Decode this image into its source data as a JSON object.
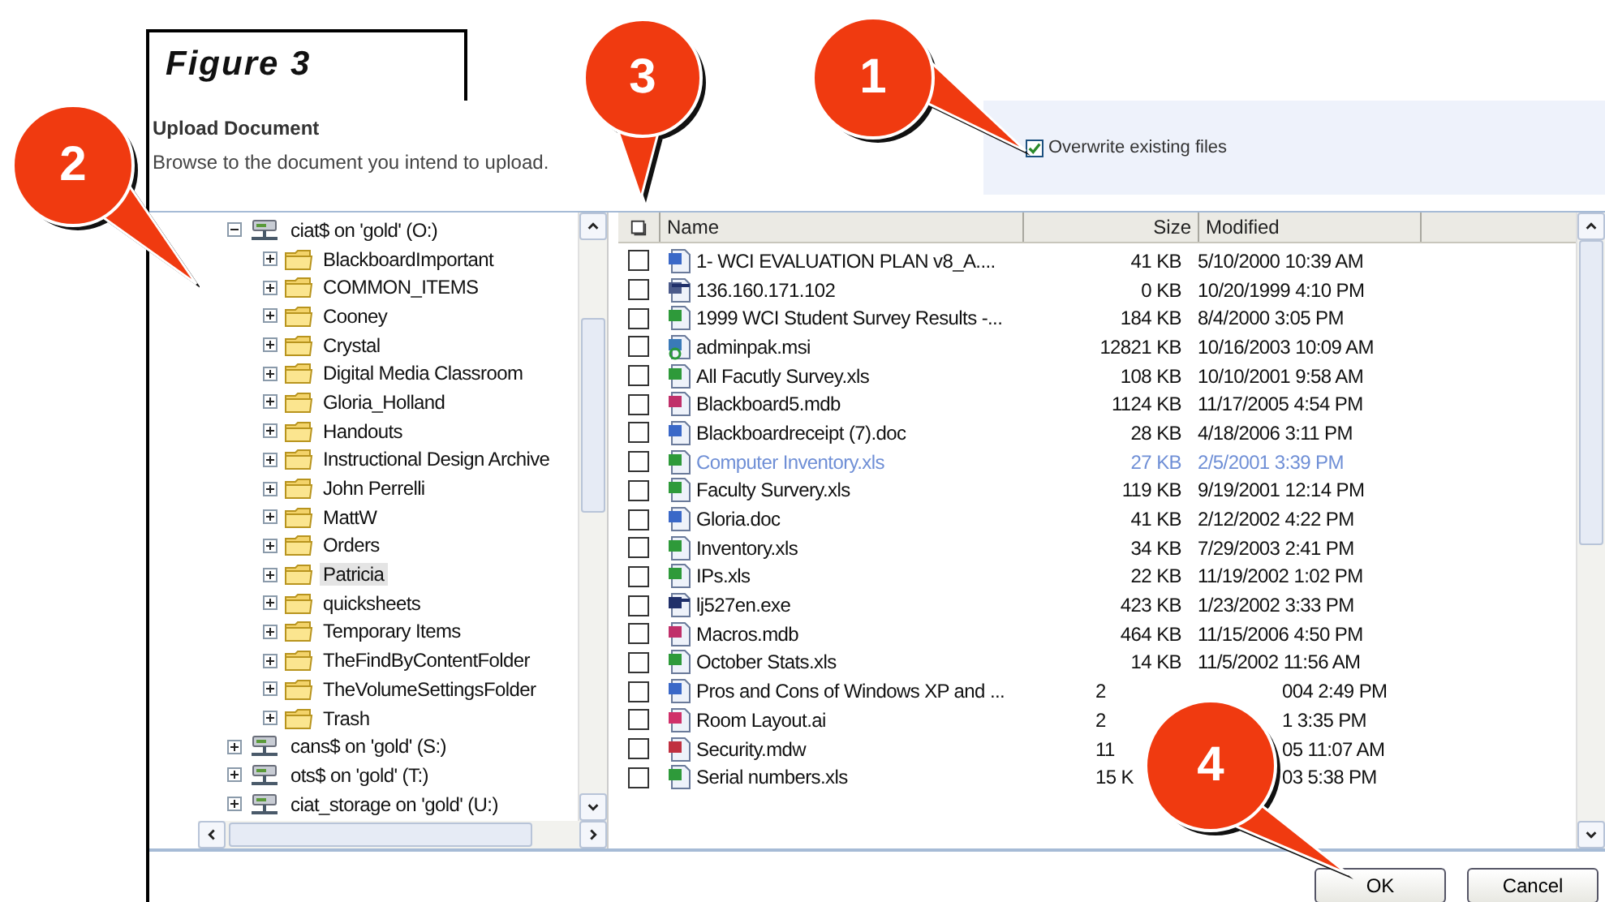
{
  "figure_label": "Figure 3",
  "dialog": {
    "title": "Upload Document",
    "instruction": "Browse to the document you intend to upload.",
    "overwrite": {
      "label": "Overwrite existing files",
      "checked": true
    }
  },
  "tree": [
    {
      "label": "ciat$ on 'gold' (O:)",
      "kind": "drive",
      "expanded": true,
      "selected": false,
      "children": [
        {
          "label": "BlackboardImportant",
          "kind": "folder",
          "expanded": false,
          "selected": false
        },
        {
          "label": "COMMON_ITEMS",
          "kind": "folder",
          "expanded": false,
          "selected": false
        },
        {
          "label": "Cooney",
          "kind": "folder",
          "expanded": false,
          "selected": false
        },
        {
          "label": "Crystal",
          "kind": "folder",
          "expanded": false,
          "selected": false
        },
        {
          "label": "Digital Media Classroom",
          "kind": "folder",
          "expanded": false,
          "selected": false
        },
        {
          "label": "Gloria_Holland",
          "kind": "folder",
          "expanded": false,
          "selected": false
        },
        {
          "label": "Handouts",
          "kind": "folder",
          "expanded": false,
          "selected": false
        },
        {
          "label": "Instructional Design Archive",
          "kind": "folder",
          "expanded": false,
          "selected": false
        },
        {
          "label": "John Perrelli",
          "kind": "folder",
          "expanded": false,
          "selected": false
        },
        {
          "label": "MattW",
          "kind": "folder",
          "expanded": false,
          "selected": false
        },
        {
          "label": "Orders",
          "kind": "folder",
          "expanded": false,
          "selected": false
        },
        {
          "label": "Patricia",
          "kind": "folder",
          "expanded": false,
          "selected": true
        },
        {
          "label": "quicksheets",
          "kind": "folder",
          "expanded": false,
          "selected": false
        },
        {
          "label": "Temporary Items",
          "kind": "folder",
          "expanded": false,
          "selected": false
        },
        {
          "label": "TheFindByContentFolder",
          "kind": "folder",
          "expanded": false,
          "selected": false
        },
        {
          "label": "TheVolumeSettingsFolder",
          "kind": "folder",
          "expanded": false,
          "selected": false
        },
        {
          "label": "Trash",
          "kind": "folder",
          "expanded": false,
          "selected": false
        }
      ]
    },
    {
      "label": "cans$ on 'gold' (S:)",
      "kind": "drive",
      "expanded": false,
      "selected": false
    },
    {
      "label": "ots$ on 'gold' (T:)",
      "kind": "drive",
      "expanded": false,
      "selected": false
    },
    {
      "label": "ciat_storage on 'gold' (U:)",
      "kind": "drive",
      "expanded": false,
      "selected": false
    }
  ],
  "files": {
    "columns": [
      "Name",
      "Size",
      "Modified"
    ],
    "rows": [
      {
        "name": "1- WCI EVALUATION PLAN v8_A....",
        "size": "41 KB",
        "modified": "5/10/2000 10:39 AM",
        "kind": "word",
        "checked": false,
        "hot": false,
        "covered": false
      },
      {
        "name": "136.160.171.102",
        "size": "0 KB",
        "modified": "10/20/1999 4:10 PM",
        "kind": "web",
        "checked": false,
        "hot": false,
        "covered": false
      },
      {
        "name": "1999 WCI Student Survey Results -...",
        "size": "184 KB",
        "modified": "8/4/2000 3:05 PM",
        "kind": "excel",
        "checked": false,
        "hot": false,
        "covered": false
      },
      {
        "name": "adminpak.msi",
        "size": "12821 KB",
        "modified": "10/16/2003 10:09 AM",
        "kind": "msi",
        "checked": false,
        "hot": false,
        "covered": false
      },
      {
        "name": "All Facutly Survey.xls",
        "size": "108 KB",
        "modified": "10/10/2001 9:58 AM",
        "kind": "excel",
        "checked": false,
        "hot": false,
        "covered": false
      },
      {
        "name": "Blackboard5.mdb",
        "size": "1124 KB",
        "modified": "11/17/2005 4:54 PM",
        "kind": "db",
        "checked": false,
        "hot": false,
        "covered": false
      },
      {
        "name": "Blackboardreceipt (7).doc",
        "size": "28 KB",
        "modified": "4/18/2006 3:11 PM",
        "kind": "word",
        "checked": false,
        "hot": false,
        "covered": false
      },
      {
        "name": "Computer Inventory.xls",
        "size": "27 KB",
        "modified": "2/5/2001 3:39 PM",
        "kind": "excel",
        "checked": false,
        "hot": true,
        "covered": false
      },
      {
        "name": "Faculty Survery.xls",
        "size": "119 KB",
        "modified": "9/19/2001 12:14 PM",
        "kind": "excel",
        "checked": false,
        "hot": false,
        "covered": false
      },
      {
        "name": "Gloria.doc",
        "size": "41 KB",
        "modified": "2/12/2002 4:22 PM",
        "kind": "word",
        "checked": false,
        "hot": false,
        "covered": false
      },
      {
        "name": "Inventory.xls",
        "size": "34 KB",
        "modified": "7/29/2003 2:41 PM",
        "kind": "excel",
        "checked": false,
        "hot": false,
        "covered": false
      },
      {
        "name": "IPs.xls",
        "size": "22 KB",
        "modified": "11/19/2002 1:02 PM",
        "kind": "excel",
        "checked": false,
        "hot": false,
        "covered": false
      },
      {
        "name": "lj527en.exe",
        "size": "423 KB",
        "modified": "1/23/2002 3:33 PM",
        "kind": "exe",
        "checked": false,
        "hot": false,
        "covered": false
      },
      {
        "name": "Macros.mdb",
        "size": "464 KB",
        "modified": "11/15/2006 4:50 PM",
        "kind": "db",
        "checked": false,
        "hot": false,
        "covered": false
      },
      {
        "name": "October Stats.xls",
        "size": "14 KB",
        "modified": "11/5/2002 11:56 AM",
        "kind": "excel",
        "checked": false,
        "hot": false,
        "covered": false
      },
      {
        "name": "Pros and Cons of Windows XP and ...",
        "size": "2",
        "modified": "004 2:49 PM",
        "kind": "word",
        "checked": false,
        "hot": false,
        "covered": true
      },
      {
        "name": "Room Layout.ai",
        "size": "2",
        "modified": "1 3:35 PM",
        "kind": "ai",
        "checked": false,
        "hot": false,
        "covered": true
      },
      {
        "name": "Security.mdw",
        "size": "11",
        "modified": "05 11:07 AM",
        "kind": "mdw",
        "checked": false,
        "hot": false,
        "covered": true
      },
      {
        "name": "Serial numbers.xls",
        "size": "15 K",
        "modified": "03 5:38 PM",
        "kind": "excel",
        "checked": false,
        "hot": false,
        "covered": true
      }
    ]
  },
  "buttons": [
    "OK",
    "Cancel"
  ],
  "callouts": [
    {
      "number": "1"
    },
    {
      "number": "2"
    },
    {
      "number": "3"
    },
    {
      "number": "4"
    }
  ]
}
